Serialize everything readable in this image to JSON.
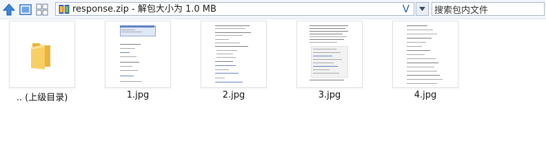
{
  "toolbar": {
    "address_path": "response.zip - 解包大小为 1.0 MB",
    "address_suffix": "V",
    "search_placeholder": "搜索包内文件"
  },
  "items": [
    {
      "label": ".. (上级目录)",
      "type": "folder"
    },
    {
      "label": "1.jpg",
      "type": "image"
    },
    {
      "label": "2.jpg",
      "type": "image"
    },
    {
      "label": "3.jpg",
      "type": "image"
    },
    {
      "label": "4.jpg",
      "type": "image"
    }
  ],
  "colors": {
    "accent": "#2c6ecb",
    "folder": "#f5c451",
    "toolbar_bg": "#f3f6fb"
  }
}
